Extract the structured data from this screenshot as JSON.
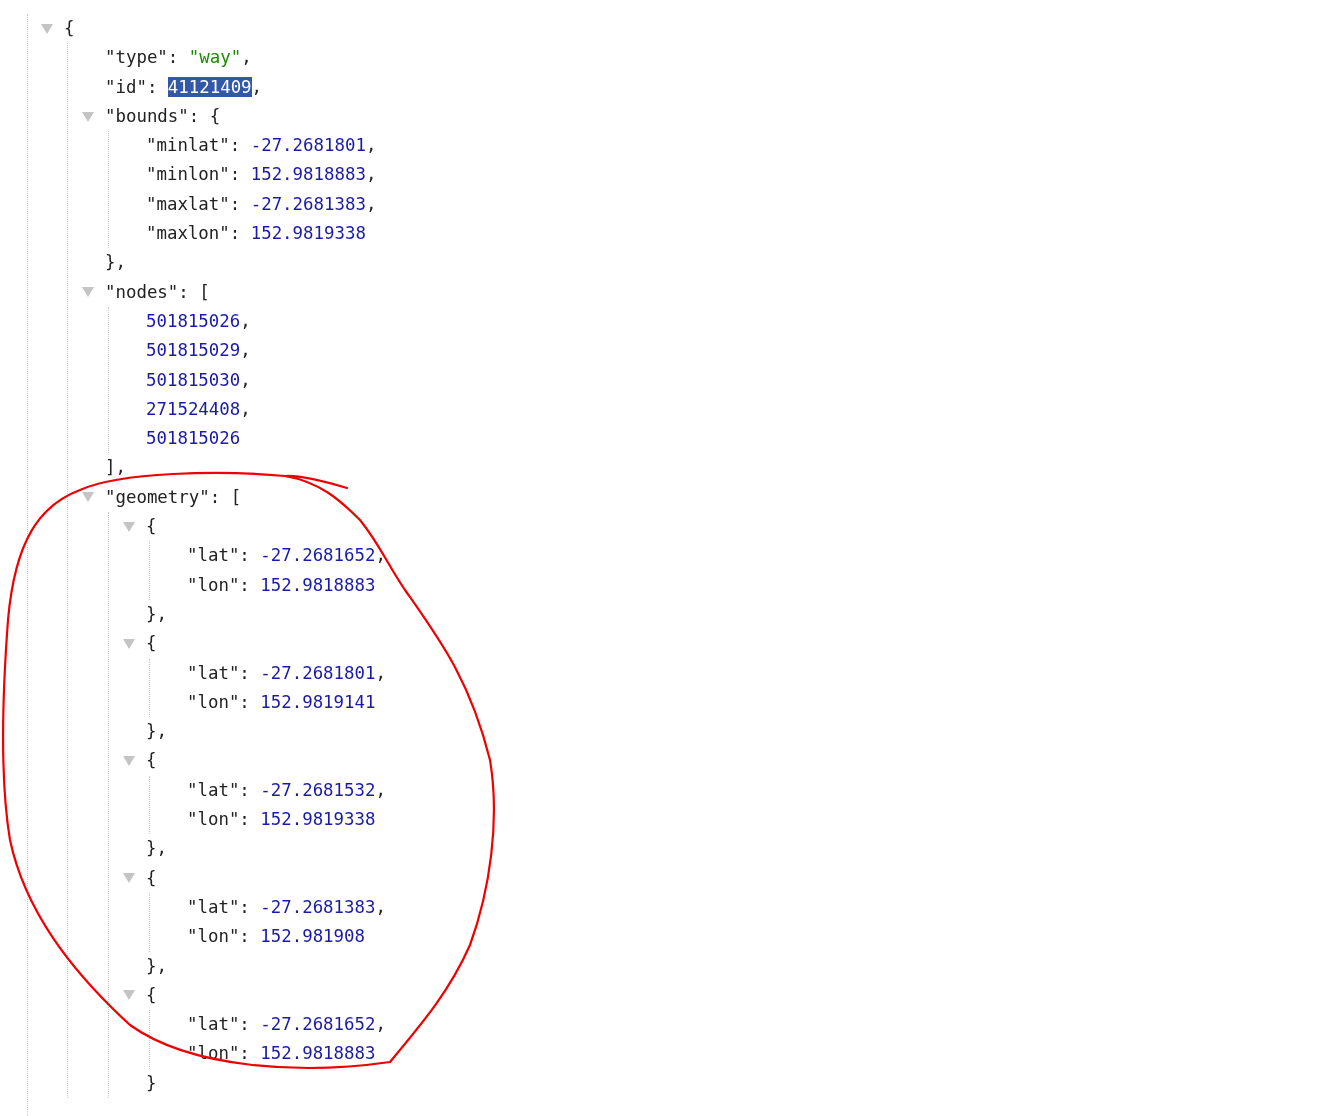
{
  "viewer": {
    "root": {
      "kind": "container",
      "open": "{",
      "expanded": true,
      "children": [
        {
          "kind": "string",
          "key": "\"type\": ",
          "value": "\"way\"",
          "comma": ",",
          "selected": false
        },
        {
          "kind": "number",
          "key": "\"id\": ",
          "value": "41121409",
          "comma": ",",
          "selected": true
        },
        {
          "kind": "container",
          "key": "\"bounds\": ",
          "open": "{",
          "expanded": true,
          "close": "},",
          "children": [
            {
              "kind": "number",
              "key": "\"minlat\": ",
              "value": "-27.2681801",
              "comma": ",",
              "selected": false
            },
            {
              "kind": "number",
              "key": "\"minlon\": ",
              "value": "152.9818883",
              "comma": ",",
              "selected": false
            },
            {
              "kind": "number",
              "key": "\"maxlat\": ",
              "value": "-27.2681383",
              "comma": ",",
              "selected": false
            },
            {
              "kind": "number",
              "key": "\"maxlon\": ",
              "value": "152.9819338",
              "selected": false
            }
          ]
        },
        {
          "kind": "container",
          "key": "\"nodes\": ",
          "open": "[",
          "expanded": true,
          "close": "],",
          "children": [
            {
              "kind": "number",
              "value": "501815026",
              "comma": ",",
              "selected": false
            },
            {
              "kind": "number",
              "value": "501815029",
              "comma": ",",
              "selected": false
            },
            {
              "kind": "number",
              "value": "501815030",
              "comma": ",",
              "selected": false
            },
            {
              "kind": "number",
              "value": "271524408",
              "comma": ",",
              "selected": false
            },
            {
              "kind": "number",
              "value": "501815026",
              "selected": false
            }
          ]
        },
        {
          "kind": "container",
          "key": "\"geometry\": ",
          "open": "[",
          "expanded": true,
          "children": [
            {
              "kind": "container",
              "open": "{",
              "expanded": true,
              "close": "},",
              "children": [
                {
                  "kind": "number",
                  "key": "\"lat\": ",
                  "value": "-27.2681652",
                  "comma": ",",
                  "selected": false
                },
                {
                  "kind": "number",
                  "key": "\"lon\": ",
                  "value": "152.9818883",
                  "selected": false
                }
              ]
            },
            {
              "kind": "container",
              "open": "{",
              "expanded": true,
              "close": "},",
              "children": [
                {
                  "kind": "number",
                  "key": "\"lat\": ",
                  "value": "-27.2681801",
                  "comma": ",",
                  "selected": false
                },
                {
                  "kind": "number",
                  "key": "\"lon\": ",
                  "value": "152.9819141",
                  "selected": false
                }
              ]
            },
            {
              "kind": "container",
              "open": "{",
              "expanded": true,
              "close": "},",
              "children": [
                {
                  "kind": "number",
                  "key": "\"lat\": ",
                  "value": "-27.2681532",
                  "comma": ",",
                  "selected": false
                },
                {
                  "kind": "number",
                  "key": "\"lon\": ",
                  "value": "152.9819338",
                  "selected": false
                }
              ]
            },
            {
              "kind": "container",
              "open": "{",
              "expanded": true,
              "close": "},",
              "children": [
                {
                  "kind": "number",
                  "key": "\"lat\": ",
                  "value": "-27.2681383",
                  "comma": ",",
                  "selected": false
                },
                {
                  "kind": "number",
                  "key": "\"lon\": ",
                  "value": "152.981908",
                  "selected": false
                }
              ]
            },
            {
              "kind": "container",
              "open": "{",
              "expanded": true,
              "close": "}",
              "children": [
                {
                  "kind": "number",
                  "key": "\"lat\": ",
                  "value": "-27.2681652",
                  "comma": ",",
                  "selected": false
                },
                {
                  "kind": "number",
                  "key": "\"lon\": ",
                  "value": "152.9818883",
                  "selected": false
                }
              ]
            }
          ]
        }
      ]
    }
  }
}
